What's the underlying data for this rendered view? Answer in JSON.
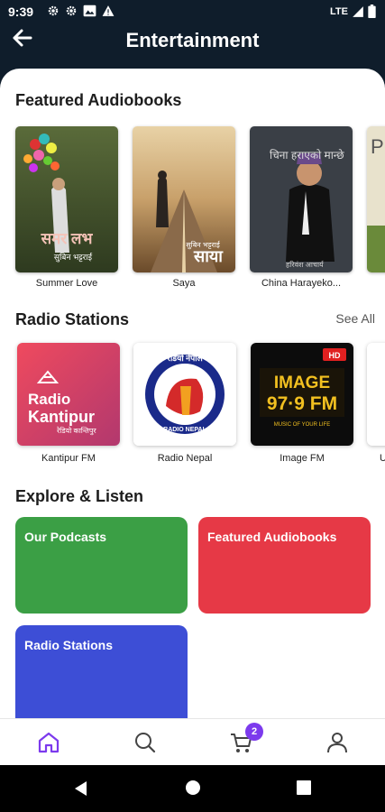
{
  "status_bar": {
    "time": "9:39",
    "network": "LTE"
  },
  "header": {
    "title": "Entertainment"
  },
  "featured": {
    "title": "Featured Audiobooks",
    "books": [
      {
        "title": "Summer Love",
        "cover_text": "समर लभ",
        "cover_subtext": "सुबिन भट्टराई"
      },
      {
        "title": "Saya",
        "cover_text": "साया",
        "cover_subtext": "सुबिन भट्टराई"
      },
      {
        "title": "China Harayeko...",
        "cover_text": "चिना हराएको मान्छे",
        "cover_subtext": "हरिवंश आचार्य"
      },
      {
        "title": "",
        "cover_text": "P"
      }
    ]
  },
  "radio": {
    "title": "Radio Stations",
    "see_all": "See All",
    "stations": [
      {
        "name": "Kantipur FM",
        "logo_line1": "Radio",
        "logo_line2": "Kantipur",
        "logo_sub": "रेडियो कान्तिपुर"
      },
      {
        "name": "Radio Nepal",
        "logo_top": "रेडियो नेपाल",
        "logo_bottom": "RADIO NEPAL"
      },
      {
        "name": "Image FM",
        "logo_line1": "IMAGE",
        "logo_line2": "97·9 FM",
        "logo_tag": "HD",
        "logo_sub": "MUSIC OF YOUR LIFE"
      },
      {
        "name": "U"
      }
    ]
  },
  "explore": {
    "title": "Explore & Listen",
    "tiles": [
      {
        "label": "Our Podcasts",
        "color": "#3b9f45"
      },
      {
        "label": "Featured Audiobooks",
        "color": "#e63946"
      },
      {
        "label": "Radio Stations",
        "color": "#3d4ed6"
      }
    ]
  },
  "bottom_nav": {
    "items": [
      {
        "icon": "home-icon",
        "active": true
      },
      {
        "icon": "search-icon"
      },
      {
        "icon": "cart-icon",
        "badge": "2"
      },
      {
        "icon": "profile-icon"
      }
    ]
  },
  "colors": {
    "accent": "#7c3aed",
    "header_bg": "#0f1d2b"
  }
}
